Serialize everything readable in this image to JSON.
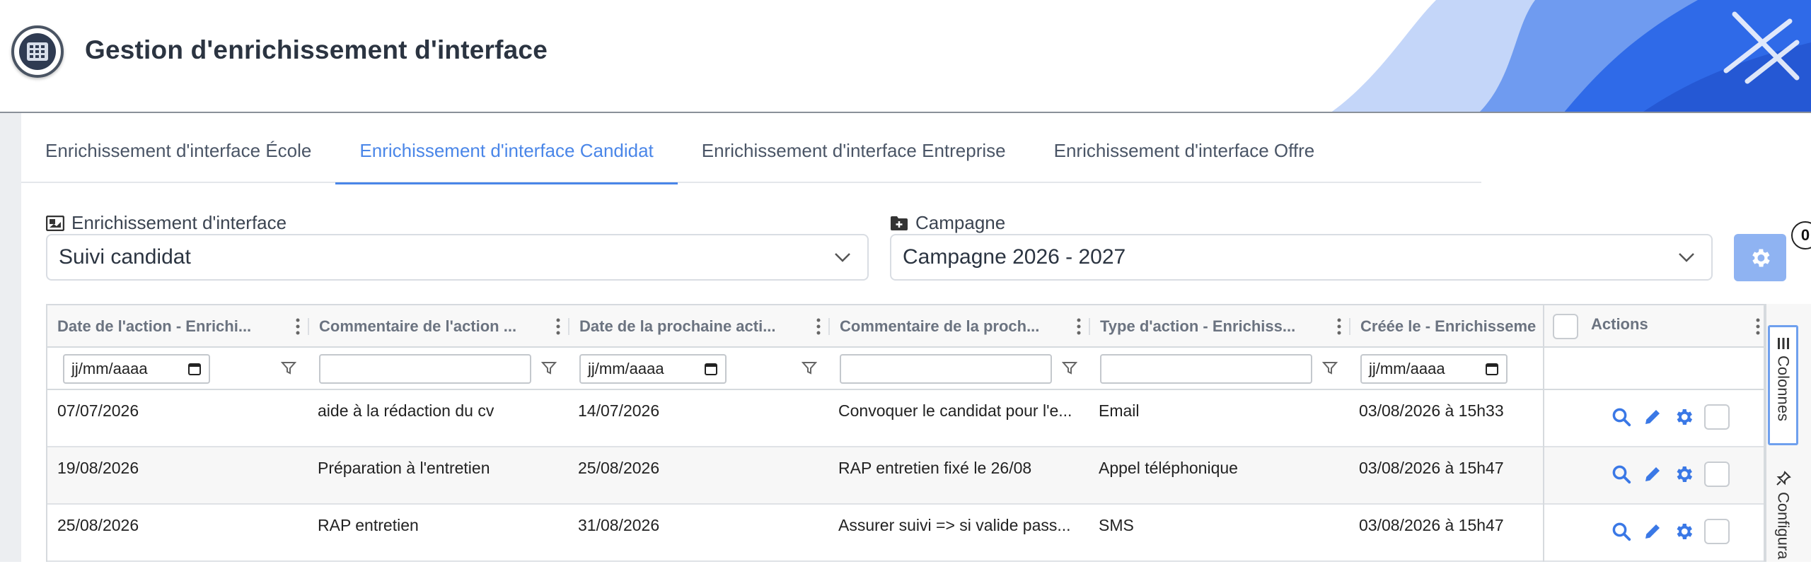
{
  "header": {
    "title": "Gestion d'enrichissement d'interface",
    "accent": "#4a86e8"
  },
  "tabs": [
    {
      "label": "Enrichissement d'interface École",
      "active": false
    },
    {
      "label": "Enrichissement d'interface Candidat",
      "active": true
    },
    {
      "label": "Enrichissement d'interface Entreprise",
      "active": false
    },
    {
      "label": "Enrichissement d'interface Offre",
      "active": false
    }
  ],
  "selectors": {
    "interface": {
      "label": "Enrichissement d'interface",
      "value": "Suivi candidat",
      "icon": "image-icon"
    },
    "campagne": {
      "label": "Campagne",
      "value": "Campagne 2026 - 2027",
      "icon": "folder-plus-icon"
    }
  },
  "settings": {
    "badge_count": "0"
  },
  "grid": {
    "columns": [
      "Date de l'action - Enrichi...",
      "Commentaire de l'action ...",
      "Date de la prochaine acti...",
      "Commentaire de la proch...",
      "Type d'action - Enrichiss...",
      "Créée le - Enrichisseme"
    ],
    "actions_header": "Actions",
    "date_placeholder": "jj/mm/aaaa",
    "rows": [
      {
        "date_action": "07/07/2026",
        "commentaire": "aide à la rédaction du cv",
        "date_prochaine": "14/07/2026",
        "commentaire_prochaine": "Convoquer le candidat pour l'e...",
        "type": "Email",
        "creee_le": "03/08/2026 à 15h33"
      },
      {
        "date_action": "19/08/2026",
        "commentaire": "Préparation à l'entretien",
        "date_prochaine": "25/08/2026",
        "commentaire_prochaine": "RAP entretien fixé le 26/08",
        "type": "Appel téléphonique",
        "creee_le": "03/08/2026 à 15h47"
      },
      {
        "date_action": "25/08/2026",
        "commentaire": "RAP entretien",
        "date_prochaine": "31/08/2026",
        "commentaire_prochaine": "Assurer suivi => si valide pass...",
        "type": "SMS",
        "creee_le": "03/08/2026 à 15h47"
      }
    ]
  },
  "side_panel": {
    "colonnes": "Colonnes",
    "configuration": "Configura"
  }
}
